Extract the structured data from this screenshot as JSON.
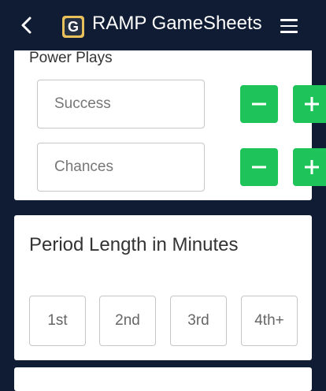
{
  "header": {
    "back_icon": "chevron-left-icon",
    "logo_letter": "G",
    "title": "RAMP GameSheets",
    "menu_icon": "hamburger-menu-icon"
  },
  "power_plays": {
    "label": "Power Plays",
    "success_placeholder": "Success",
    "chances_placeholder": "Chances"
  },
  "period_length": {
    "title": "Period Length in Minutes",
    "periods": [
      "1st",
      "2nd",
      "3rd",
      "4th+"
    ]
  },
  "colors": {
    "header_bg": "#0f1c33",
    "button_green": "#1ec45a",
    "card_bg": "#ffffff"
  }
}
